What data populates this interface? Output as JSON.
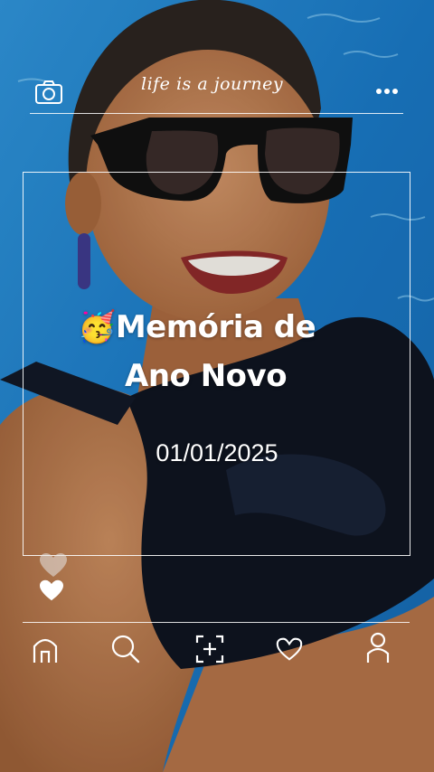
{
  "header": {
    "tagline": "life is a journey",
    "camera_icon": "camera-icon",
    "more_icon": "more-dots-icon"
  },
  "card": {
    "emoji": "🥳",
    "title_line1": "Memória de",
    "title_line2": "Ano Novo",
    "date": "01/01/2025"
  },
  "bottom_nav": {
    "items": [
      "home-icon",
      "search-icon",
      "add-icon",
      "heart-icon",
      "profile-icon"
    ]
  },
  "colors": {
    "pool_blue": "#1f7fc9",
    "swimsuit": "#0f1420",
    "skin": "#b9784c",
    "overlay_white": "#ffffff"
  }
}
